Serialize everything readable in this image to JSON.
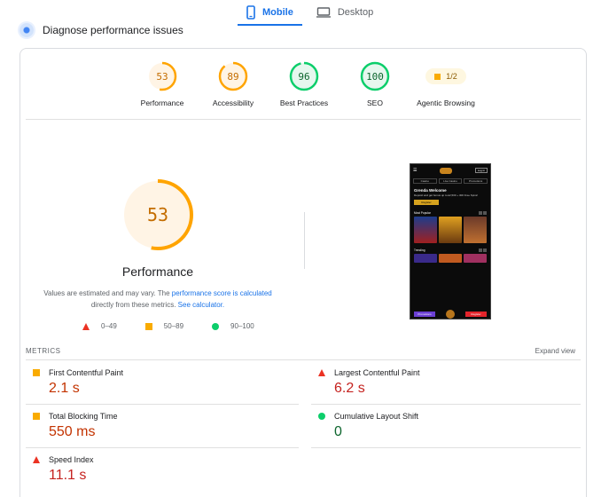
{
  "tabs": [
    {
      "label": "Mobile",
      "active": true
    },
    {
      "label": "Desktop",
      "active": false
    }
  ],
  "diagnose": {
    "label": "Diagnose performance issues"
  },
  "scores": [
    {
      "value": "53",
      "label": "Performance",
      "color": "#ffa400",
      "fraction": 0.53
    },
    {
      "value": "89",
      "label": "Accessibility",
      "color": "#ffa400",
      "fraction": 0.89
    },
    {
      "value": "96",
      "label": "Best Practices",
      "color": "#0cce6b",
      "fraction": 0.96
    },
    {
      "value": "100",
      "label": "SEO",
      "color": "#0cce6b",
      "fraction": 1.0
    }
  ],
  "agentic": {
    "value": "1/2",
    "label": "Agentic Browsing"
  },
  "main_score": {
    "value": "53",
    "title": "Performance",
    "fraction": 0.53,
    "color": "#ffa400"
  },
  "note": {
    "text1": "Values are estimated and may vary. The ",
    "link1": "performance score is calculated",
    "text2": " directly from these metrics. ",
    "link2": "See calculator."
  },
  "legend": [
    {
      "shape": "triangle",
      "label": "0–49"
    },
    {
      "shape": "square",
      "label": "50–89"
    },
    {
      "shape": "circle",
      "label": "90–100"
    }
  ],
  "phone": {
    "login": "Log in",
    "nav": [
      "Casino",
      "Live Casino",
      "Promotions"
    ],
    "hero_title": "Grenda Welcome",
    "hero_text": "Deposit and get bonus up to £2,500 + 300 Free Spins!",
    "hero_button": "Register",
    "section1": "Most Popular",
    "section2": "Trending",
    "foot_left": "Promotions",
    "foot_right": "Register"
  },
  "metrics": {
    "title": "METRICS",
    "expand": "Expand view",
    "items": [
      {
        "label": "First Contentful Paint",
        "value": "2.1 s",
        "status": "average"
      },
      {
        "label": "Largest Contentful Paint",
        "value": "6.2 s",
        "status": "fail"
      },
      {
        "label": "Total Blocking Time",
        "value": "550 ms",
        "status": "average"
      },
      {
        "label": "Cumulative Layout Shift",
        "value": "0",
        "status": "pass"
      },
      {
        "label": "Speed Index",
        "value": "11.1 s",
        "status": "fail"
      }
    ]
  }
}
